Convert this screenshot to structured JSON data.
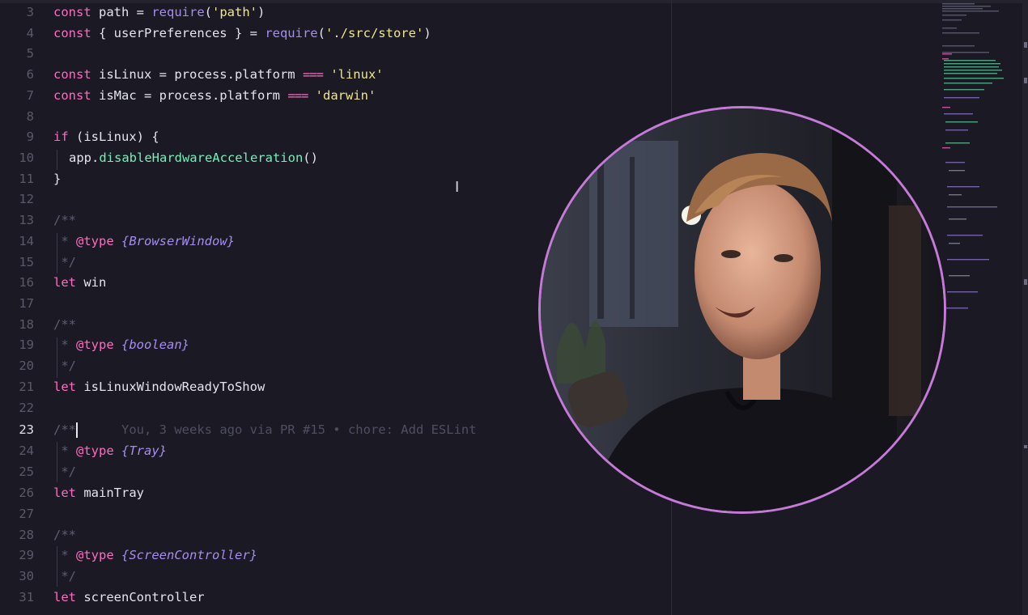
{
  "editor": {
    "active_line": "23",
    "line_numbers": [
      "3",
      "4",
      "5",
      "6",
      "7",
      "8",
      "9",
      "10",
      "11",
      "12",
      "13",
      "14",
      "15",
      "16",
      "17",
      "18",
      "19",
      "20",
      "21",
      "22",
      "23",
      "24",
      "25",
      "26",
      "27",
      "28",
      "29",
      "30",
      "31"
    ],
    "code": {
      "l3": {
        "kw": "const",
        "name": " path = ",
        "fn": "require",
        "open": "(",
        "str": "'path'",
        "close": ")"
      },
      "l4": {
        "kw": "const",
        "name": " { userPreferences } = ",
        "fn": "require",
        "open": "(",
        "str": "'./src/store'",
        "close": ")"
      },
      "l6": {
        "kw": "const",
        "name": " isLinux = process.platform ",
        "op": "===",
        "sp": " ",
        "str": "'linux'"
      },
      "l7": {
        "kw": "const",
        "name": " isMac = process.platform ",
        "op": "===",
        "sp": " ",
        "str": "'darwin'"
      },
      "l9": {
        "kw": "if",
        "rest": " (isLinux) {"
      },
      "l10": {
        "obj": "app.",
        "call": "disableHardwareAcceleration",
        "paren": "()"
      },
      "l11": {
        "text": "}"
      },
      "l13": {
        "text": "/**"
      },
      "l14": {
        "star": " * ",
        "tag": "@type",
        "sp": " ",
        "type": "{BrowserWindow}"
      },
      "l15": {
        "text": " */"
      },
      "l16": {
        "kw": "let",
        "name": " win"
      },
      "l18": {
        "text": "/**"
      },
      "l19": {
        "star": " * ",
        "tag": "@type",
        "sp": " ",
        "type": "{boolean}"
      },
      "l20": {
        "text": " */"
      },
      "l21": {
        "kw": "let",
        "name": " isLinuxWindowReadyToShow"
      },
      "l23": {
        "text": "/**",
        "blame": "You, 3 weeks ago via PR #15 • chore: Add ESLint"
      },
      "l24": {
        "star": " * ",
        "tag": "@type",
        "sp": " ",
        "type": "{Tray}"
      },
      "l25": {
        "text": " */"
      },
      "l26": {
        "kw": "let",
        "name": " mainTray"
      },
      "l28": {
        "text": "/**"
      },
      "l29": {
        "star": " * ",
        "tag": "@type",
        "sp": " ",
        "type": "{ScreenController}"
      },
      "l30": {
        "text": " */"
      },
      "l31": {
        "kw": "let",
        "name": " screenController"
      }
    }
  },
  "icons": {
    "cursor": "text-cursor-icon",
    "webcam": "webcam-overlay"
  },
  "colors": {
    "background": "#1b1a24",
    "keyword": "#ff6ac1",
    "function": "#a58cf0",
    "string": "#f0e68c",
    "method": "#72f1b8",
    "comment": "#5d5c72",
    "webcam_ring": "#c57ad8"
  }
}
